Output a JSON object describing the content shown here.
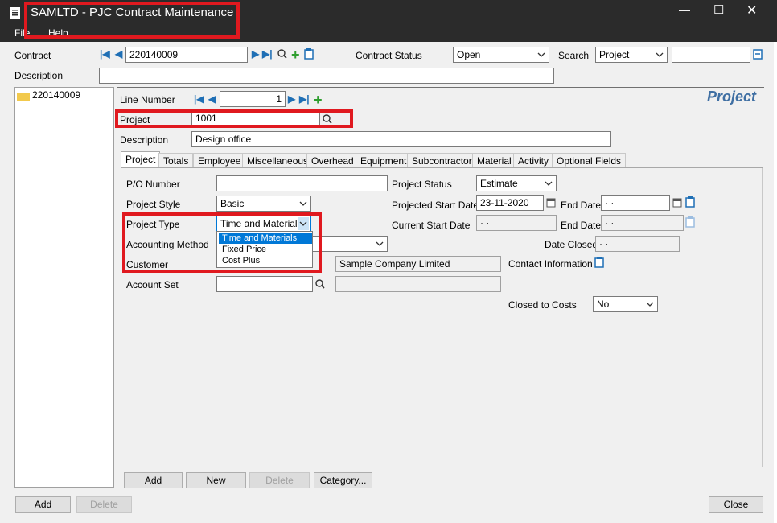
{
  "window": {
    "title": "SAMLTD - PJC Contract Maintenance",
    "menu": [
      "File",
      "Help"
    ],
    "controls": {
      "minimize": "—",
      "maximize": "☐",
      "close": "✕"
    }
  },
  "header": {
    "contract_label": "Contract",
    "contract_value": "220140009",
    "contract_status_label": "Contract Status",
    "contract_status_value": "Open",
    "search_label": "Search",
    "search_by_value": "Project",
    "search_value": "",
    "description_label": "Description",
    "description_value": ""
  },
  "tree": {
    "items": [
      {
        "label": "220140009",
        "icon": "folder-icon"
      }
    ]
  },
  "detail": {
    "line_number_label": "Line Number",
    "line_number_value": "1",
    "section_title": "Project",
    "project_label": "Project",
    "project_value": "1001",
    "description_label": "Description",
    "description_value": "Design office"
  },
  "tabs": [
    {
      "label": "Project",
      "active": true
    },
    {
      "label": "Totals"
    },
    {
      "label": "Employee"
    },
    {
      "label": "Miscellaneous"
    },
    {
      "label": "Overhead"
    },
    {
      "label": "Equipment"
    },
    {
      "label": "Subcontractor"
    },
    {
      "label": "Material"
    },
    {
      "label": "Activity"
    },
    {
      "label": "Optional Fields"
    }
  ],
  "form": {
    "po_number_label": "P/O Number",
    "po_number_value": "",
    "project_style_label": "Project Style",
    "project_style_value": "Basic",
    "project_type_label": "Project Type",
    "project_type_value": "Time and Materials",
    "project_type_options": [
      "Time and Materials",
      "Fixed Price",
      "Cost Plus"
    ],
    "accounting_method_label": "Accounting Method",
    "accounting_method_value": "",
    "customer_label": "Customer",
    "customer_name": "Sample Company Limited",
    "account_set_label": "Account Set",
    "account_set_value": "",
    "account_set_desc": "",
    "project_status_label": "Project Status",
    "project_status_value": "Estimate",
    "projected_start_label": "Projected Start Date",
    "projected_start_value": "23-11-2020",
    "end_date_label": "End Date",
    "end_date_value": "· ·",
    "current_start_label": "Current Start Date",
    "current_start_value": "· ·",
    "current_end_label": "End Date",
    "current_end_value": "· ·",
    "date_closed_label": "Date Closed",
    "date_closed_value": "· ·",
    "contact_info_label": "Contact Information",
    "closed_to_costs_label": "Closed to Costs",
    "closed_to_costs_value": "No"
  },
  "inner_buttons": {
    "add": "Add",
    "new": "New",
    "delete": "Delete",
    "category": "Category..."
  },
  "footer_buttons": {
    "add": "Add",
    "delete": "Delete",
    "close": "Close"
  },
  "colors": {
    "highlight_box": "#e0191f",
    "nav_blue": "#1f6fb5",
    "plus_green": "#2e9e2e",
    "selection": "#0078d7"
  }
}
